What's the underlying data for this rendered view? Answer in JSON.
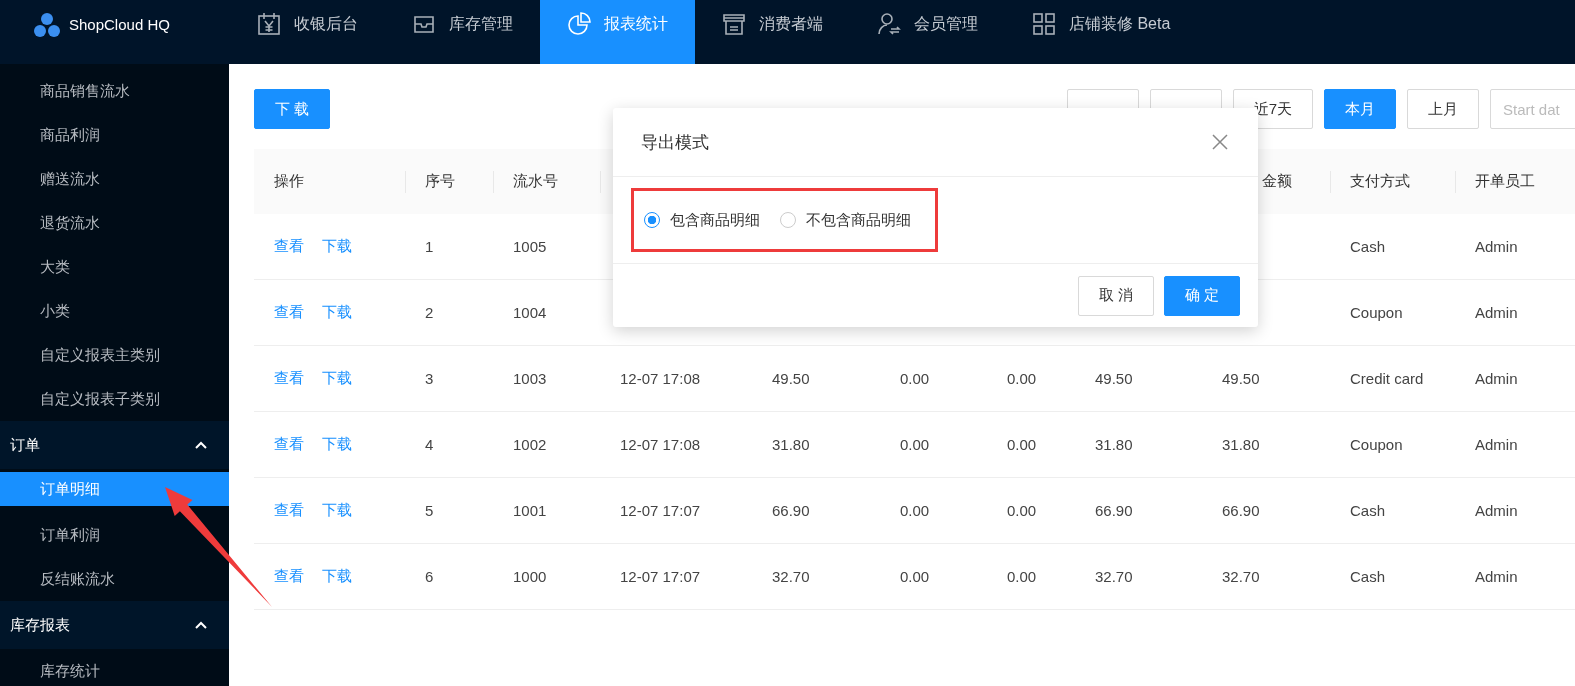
{
  "app": {
    "name": "ShopCloud HQ"
  },
  "nav": [
    {
      "label": "收银后台",
      "selected": false
    },
    {
      "label": "库存管理",
      "selected": false
    },
    {
      "label": "报表统计",
      "selected": true
    },
    {
      "label": "消费者端",
      "selected": false
    },
    {
      "label": "会员管理",
      "selected": false
    },
    {
      "label": "店铺装修 Beta",
      "selected": false
    }
  ],
  "sidebar": {
    "items": [
      {
        "kind": "item",
        "label": "商品销售流水",
        "selected": false
      },
      {
        "kind": "item",
        "label": "商品利润",
        "selected": false
      },
      {
        "kind": "item",
        "label": "赠送流水",
        "selected": false
      },
      {
        "kind": "item",
        "label": "退货流水",
        "selected": false
      },
      {
        "kind": "item",
        "label": "大类",
        "selected": false
      },
      {
        "kind": "item",
        "label": "小类",
        "selected": false
      },
      {
        "kind": "item",
        "label": "自定义报表主类别",
        "selected": false
      },
      {
        "kind": "item",
        "label": "自定义报表子类别",
        "selected": false
      },
      {
        "kind": "group",
        "label": "订单",
        "expanded": true,
        "children": [
          {
            "kind": "item",
            "label": "订单明细",
            "selected": true
          },
          {
            "kind": "item",
            "label": "订单利润",
            "selected": false
          },
          {
            "kind": "item",
            "label": "反结账流水",
            "selected": false
          }
        ]
      },
      {
        "kind": "group",
        "label": "库存报表",
        "expanded": true,
        "children": [
          {
            "kind": "item",
            "label": "库存统计",
            "selected": false
          }
        ]
      }
    ]
  },
  "toolbar": {
    "download": "下 载",
    "ranges": [
      {
        "selected": false
      },
      {
        "selected": false
      },
      {
        "label": "近7天",
        "selected": false
      },
      {
        "label": "本月",
        "selected": true
      },
      {
        "label": "上月",
        "selected": false
      }
    ],
    "start_date": {
      "placeholder": "Start dat"
    }
  },
  "table": {
    "columns": [
      "操作",
      "序号",
      "流水号",
      null,
      null,
      null,
      null,
      null,
      "金额",
      "支付方式",
      "开单员工"
    ],
    "rows": [
      {
        "cells": [
          [
            "查看",
            "下载"
          ],
          "1",
          "1005",
          null,
          null,
          null,
          null,
          null,
          null,
          "Cash",
          "Admin"
        ]
      },
      {
        "cells": [
          [
            "查看",
            "下载"
          ],
          "2",
          "1004",
          null,
          null,
          null,
          null,
          null,
          null,
          "Coupon",
          "Admin"
        ]
      },
      {
        "cells": [
          [
            "查看",
            "下载"
          ],
          "3",
          "1003",
          "12-07 17:08",
          "49.50",
          "0.00",
          "0.00",
          "49.50",
          "49.50",
          "Credit card",
          "Admin"
        ]
      },
      {
        "cells": [
          [
            "查看",
            "下载"
          ],
          "4",
          "1002",
          "12-07 17:08",
          "31.80",
          "0.00",
          "0.00",
          "31.80",
          "31.80",
          "Coupon",
          "Admin"
        ]
      },
      {
        "cells": [
          [
            "查看",
            "下载"
          ],
          "5",
          "1001",
          "12-07 17:07",
          "66.90",
          "0.00",
          "0.00",
          "66.90",
          "66.90",
          "Cash",
          "Admin"
        ]
      },
      {
        "cells": [
          [
            "查看",
            "下载"
          ],
          "6",
          "1000",
          "12-07 17:07",
          "32.70",
          "0.00",
          "0.00",
          "32.70",
          "32.70",
          "Cash",
          "Admin"
        ]
      }
    ]
  },
  "modal": {
    "title": "导出模式",
    "highlighted": true,
    "options": [
      {
        "label": "包含商品明细",
        "selected": true
      },
      {
        "label": "不包含商品明细",
        "selected": false
      }
    ],
    "buttons": [
      {
        "label": "取 消",
        "kind": "default"
      },
      {
        "label": "确 定",
        "kind": "primary"
      }
    ]
  },
  "annotations": [
    {
      "kind": "arrow"
    }
  ]
}
